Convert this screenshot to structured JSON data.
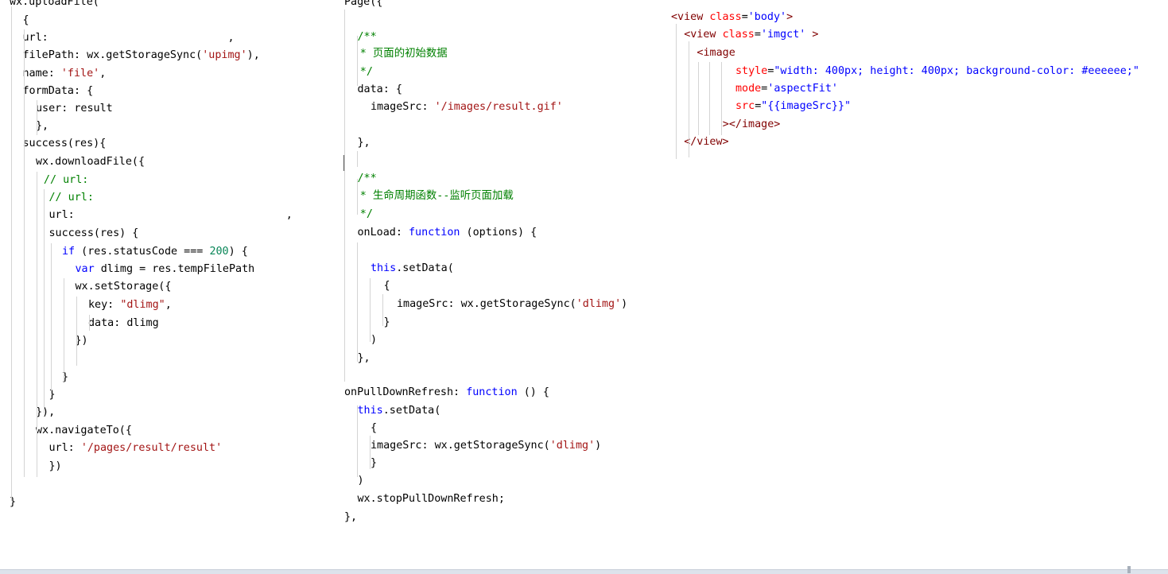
{
  "colors": {
    "default": "#000000",
    "string": "#a31515",
    "keyword": "#0000ff",
    "comment": "#008000",
    "number": "#098658",
    "tag": "#800000",
    "attr_name": "#ff0000",
    "attr_value": "#0000ff"
  },
  "panels": [
    {
      "name": "upload-code-panel",
      "lines": [
        [
          [
            "wx.uploadFile(",
            "default"
          ]
        ],
        [
          [
            "{",
            "default"
          ]
        ],
        [
          [
            "url:",
            "default"
          ],
          [
            "                            ,",
            "default"
          ]
        ],
        [
          [
            "filePath: wx.getStorageSync(",
            "default"
          ],
          [
            "'upimg'",
            "string"
          ],
          [
            "),",
            "default"
          ]
        ],
        [
          [
            "name: ",
            "default"
          ],
          [
            "'file'",
            "string"
          ],
          [
            ",",
            "default"
          ]
        ],
        [
          [
            "formData: {",
            "default"
          ]
        ],
        [
          [
            "user: result",
            "default"
          ]
        ],
        [
          [
            "},",
            "default"
          ]
        ],
        [
          [
            "success(res){",
            "default"
          ]
        ],
        [
          [
            "wx.downloadFile({",
            "default"
          ]
        ],
        [
          [
            "// url:",
            "comment"
          ]
        ],
        [
          [
            "// url:",
            "comment"
          ]
        ],
        [
          [
            "url:",
            "default"
          ],
          [
            "                                 ,",
            "default"
          ]
        ],
        [
          [
            "success(res) {",
            "default"
          ]
        ],
        [
          [
            "if",
            "keyword"
          ],
          [
            " (res.statusCode === ",
            "default"
          ],
          [
            "200",
            "number"
          ],
          [
            ") {",
            "default"
          ]
        ],
        [
          [
            "var",
            "keyword"
          ],
          [
            " dlimg = res.tempFilePath",
            "default"
          ]
        ],
        [
          [
            "wx.setStorage({",
            "default"
          ]
        ],
        [
          [
            "key: ",
            "default"
          ],
          [
            "\"dlimg\"",
            "string"
          ],
          [
            ",",
            "default"
          ]
        ],
        [
          [
            "data: dlimg",
            "default"
          ]
        ],
        [
          [
            "})",
            "default"
          ]
        ],
        [],
        [
          [
            "}",
            "default"
          ]
        ],
        [
          [
            "}",
            "default"
          ]
        ],
        [
          [
            "}),",
            "default"
          ]
        ],
        [
          [
            "wx.navigateTo({",
            "default"
          ]
        ],
        [
          [
            "url: ",
            "default"
          ],
          [
            "'/pages/result/result'",
            "string"
          ]
        ],
        [
          [
            "})",
            "default"
          ]
        ],
        [],
        [
          [
            "}",
            "default"
          ]
        ]
      ]
    },
    {
      "name": "page-code-panel",
      "lines": [
        [
          [
            "Page({",
            "default"
          ]
        ],
        [],
        [
          [
            "/**",
            "comment"
          ]
        ],
        [
          [
            "* 页面的初始数据",
            "comment"
          ]
        ],
        [
          [
            "*/",
            "comment"
          ]
        ],
        [
          [
            "data: {",
            "default"
          ]
        ],
        [
          [
            "imageSrc: ",
            "default"
          ],
          [
            "'/images/result.gif'",
            "string"
          ]
        ],
        [],
        [
          [
            "},",
            "default"
          ]
        ],
        [],
        [
          [
            "/**",
            "comment"
          ]
        ],
        [
          [
            "* 生命周期函数--监听页面加载",
            "comment"
          ]
        ],
        [
          [
            "*/",
            "comment"
          ]
        ],
        [
          [
            "onLoad: ",
            "default"
          ],
          [
            "function",
            "keyword"
          ],
          [
            " (options) {",
            "default"
          ]
        ],
        [],
        [
          [
            "this",
            "keyword"
          ],
          [
            ".setData(",
            "default"
          ]
        ],
        [
          [
            "{",
            "default"
          ]
        ],
        [
          [
            "imageSrc: wx.getStorageSync(",
            "default"
          ],
          [
            "'dlimg'",
            "string"
          ],
          [
            ")",
            "default"
          ]
        ],
        [
          [
            "}",
            "default"
          ]
        ],
        [
          [
            ")",
            "default"
          ]
        ],
        [
          [
            "},",
            "default"
          ]
        ],
        [],
        [
          [
            "onPullDownRefresh: ",
            "default"
          ],
          [
            "function",
            "keyword"
          ],
          [
            " () {",
            "default"
          ]
        ],
        [
          [
            "this",
            "keyword"
          ],
          [
            ".setData(",
            "default"
          ]
        ],
        [
          [
            "{",
            "default"
          ]
        ],
        [
          [
            "imageSrc: wx.getStorageSync(",
            "default"
          ],
          [
            "'dlimg'",
            "string"
          ],
          [
            ")",
            "default"
          ]
        ],
        [
          [
            "}",
            "default"
          ]
        ],
        [
          [
            ")",
            "default"
          ]
        ],
        [
          [
            "wx.stopPullDownRefresh;",
            "default"
          ]
        ],
        [
          [
            "},",
            "default"
          ]
        ]
      ]
    },
    {
      "name": "wxml-code-panel",
      "lines": [
        [
          [
            "<view ",
            "tag"
          ],
          [
            "class",
            "attr_name"
          ],
          [
            "=",
            "default"
          ],
          [
            "'body'",
            "attr_value"
          ],
          [
            ">",
            "tag"
          ]
        ],
        [
          [
            "<view ",
            "tag"
          ],
          [
            "class",
            "attr_name"
          ],
          [
            "=",
            "default"
          ],
          [
            "'imgct'",
            "attr_value"
          ],
          [
            " >",
            "tag"
          ]
        ],
        [
          [
            "<image",
            "tag"
          ]
        ],
        [
          [
            "style",
            "attr_name"
          ],
          [
            "=",
            "default"
          ],
          [
            "\"width: 400px; height: 400px; background-color: #eeeeee;\"",
            "attr_value"
          ]
        ],
        [
          [
            "mode",
            "attr_name"
          ],
          [
            "=",
            "default"
          ],
          [
            "'aspectFit'",
            "attr_value"
          ]
        ],
        [
          [
            "src",
            "attr_name"
          ],
          [
            "=",
            "default"
          ],
          [
            "\"{{imageSrc}}\"",
            "attr_value"
          ]
        ],
        [
          [
            "></image>",
            "tag"
          ]
        ],
        [
          [
            "</view>",
            "tag"
          ]
        ],
        []
      ]
    }
  ]
}
